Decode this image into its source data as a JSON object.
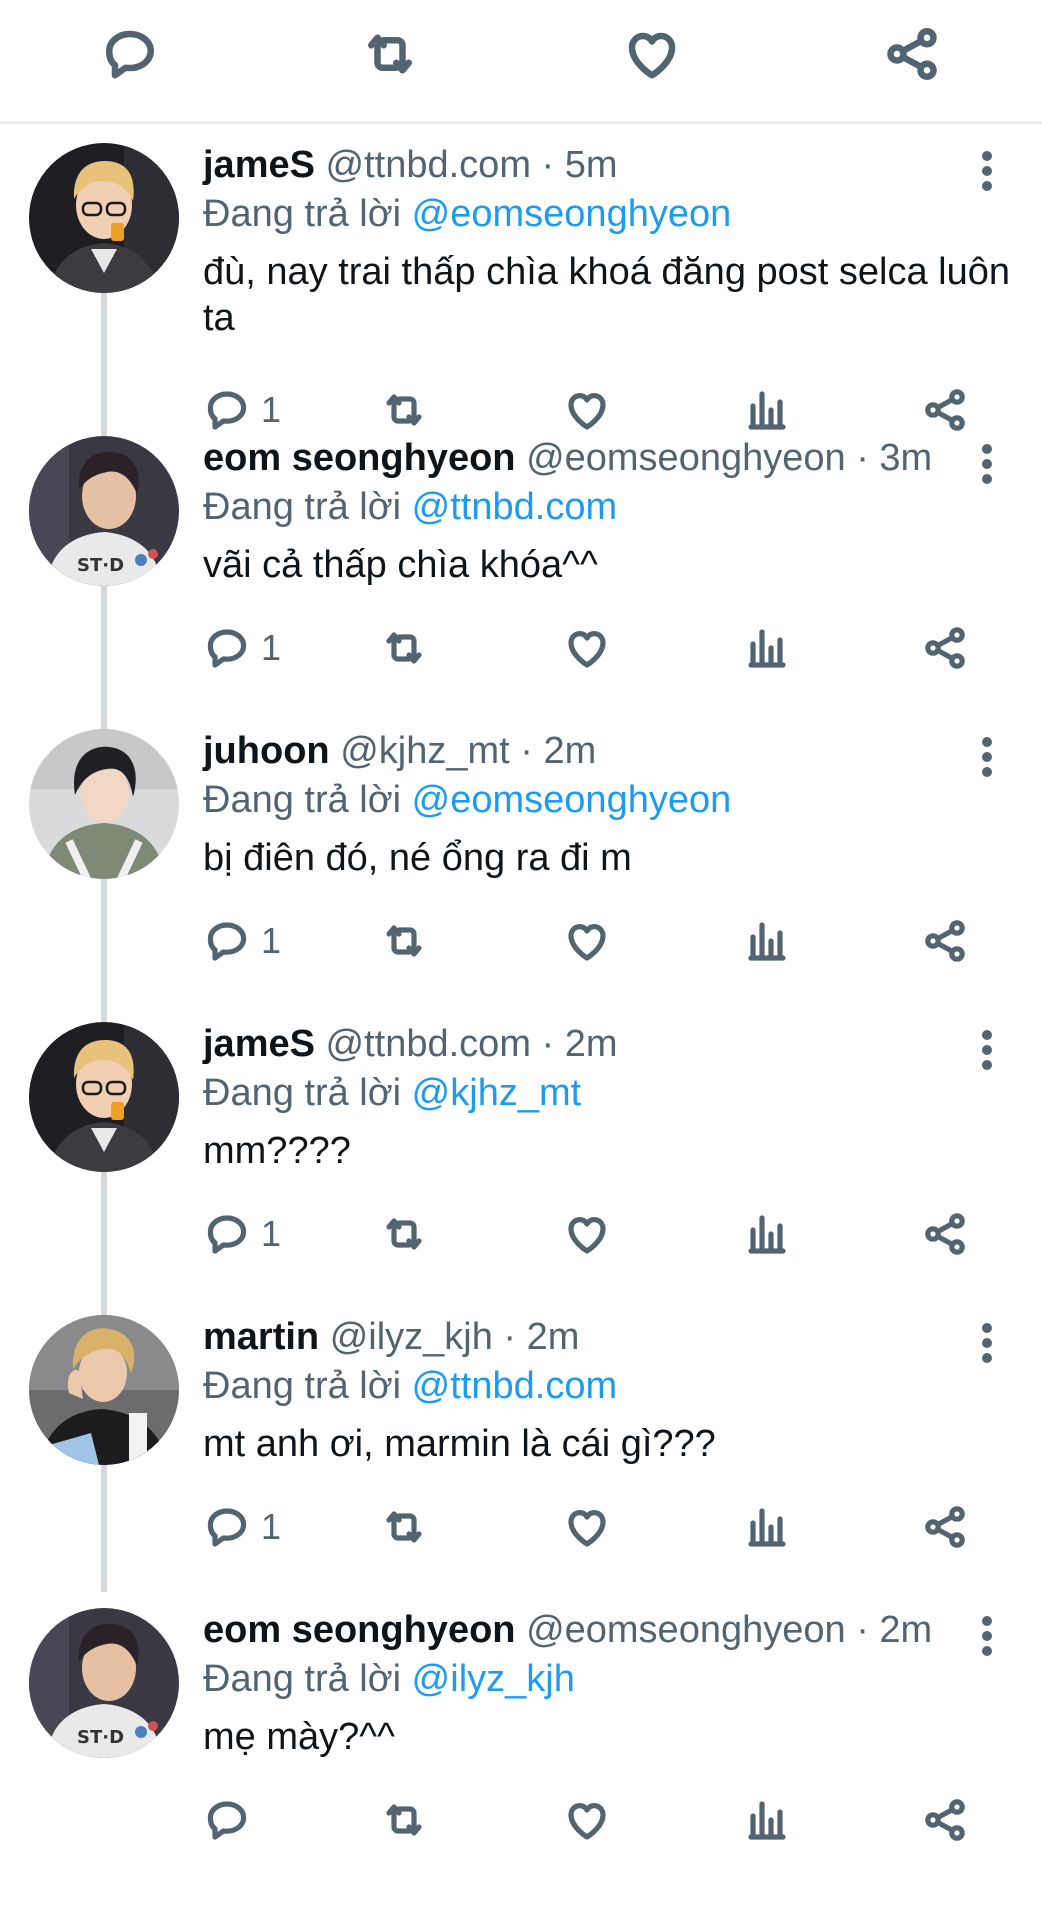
{
  "top_actions": {
    "icons": [
      "reply-icon",
      "retweet-icon",
      "like-icon",
      "share-icon"
    ]
  },
  "reply_prefix": "Đang trả lời",
  "tweets": [
    {
      "name": "jameS",
      "handle": "@ttnbd.com",
      "time": "5m",
      "replying_to": "@eomseonghyeon",
      "text": "đù, nay trai thấp chìa khoá đăng post selca luôn ta",
      "reply_count": "1"
    },
    {
      "name": "eom seonghyeon",
      "handle": "@eomseonghyeon",
      "time": "3m",
      "replying_to": "@ttnbd.com",
      "text": "vãi cả thấp chìa khóa^^",
      "reply_count": "1"
    },
    {
      "name": "juhoon",
      "handle": "@kjhz_mt",
      "time": "2m",
      "replying_to": "@eomseonghyeon",
      "text": "bị điên đó, né ổng ra đi m",
      "reply_count": "1"
    },
    {
      "name": "jameS",
      "handle": "@ttnbd.com",
      "time": "2m",
      "replying_to": "@kjhz_mt",
      "text": "mm????",
      "reply_count": "1"
    },
    {
      "name": "martin",
      "handle": "@ilyz_kjh",
      "time": "2m",
      "replying_to": "@ttnbd.com",
      "text": "mt anh ơi, marmin là cái gì???",
      "reply_count": "1"
    },
    {
      "name": "eom seonghyeon",
      "handle": "@eomseonghyeon",
      "time": "2m",
      "replying_to": "@ilyz_kjh",
      "text": "mẹ mày?^^",
      "reply_count": ""
    }
  ],
  "colors": {
    "text": "#0f1419",
    "muted": "#536471",
    "link": "#1d9bf0",
    "thread_line": "#d5d9dc"
  }
}
